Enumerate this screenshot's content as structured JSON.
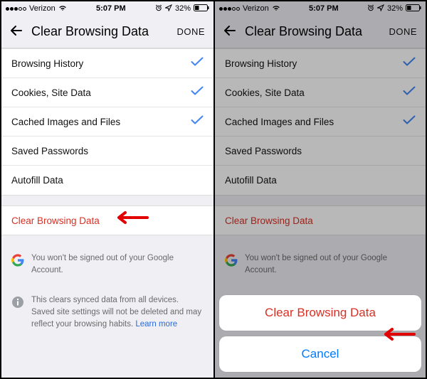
{
  "status": {
    "carrier": "Verizon",
    "time": "5:07 PM",
    "battery": "32%"
  },
  "header": {
    "title": "Clear Browsing Data",
    "done": "DONE"
  },
  "items": [
    {
      "label": "Browsing History",
      "checked": true
    },
    {
      "label": "Cookies, Site Data",
      "checked": true
    },
    {
      "label": "Cached Images and Files",
      "checked": true
    },
    {
      "label": "Saved Passwords",
      "checked": false
    },
    {
      "label": "Autofill Data",
      "checked": false
    }
  ],
  "clear_label": "Clear Browsing Data",
  "info1": "You won't be signed out of your Google Account.",
  "info2": "This clears synced data from all devices. Saved site settings will not be deleted and may reflect your browsing habits. ",
  "learn_more": "Learn more",
  "sheet": {
    "action": "Clear Browsing Data",
    "cancel": "Cancel"
  }
}
